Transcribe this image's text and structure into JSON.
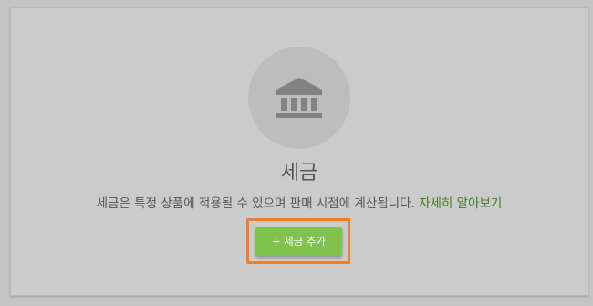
{
  "empty_state": {
    "icon": "bank-icon",
    "title": "세금",
    "description": "세금은 특정 상품에 적용될 수 있으며 판매 시점에 계산됩니다.",
    "learn_more_link": "자세히 알아보기",
    "add_button_label": "+ 세금 추가"
  },
  "colors": {
    "link": "#3f7d1e",
    "button": "#7fc24c",
    "highlight": "#ee7f2d"
  }
}
